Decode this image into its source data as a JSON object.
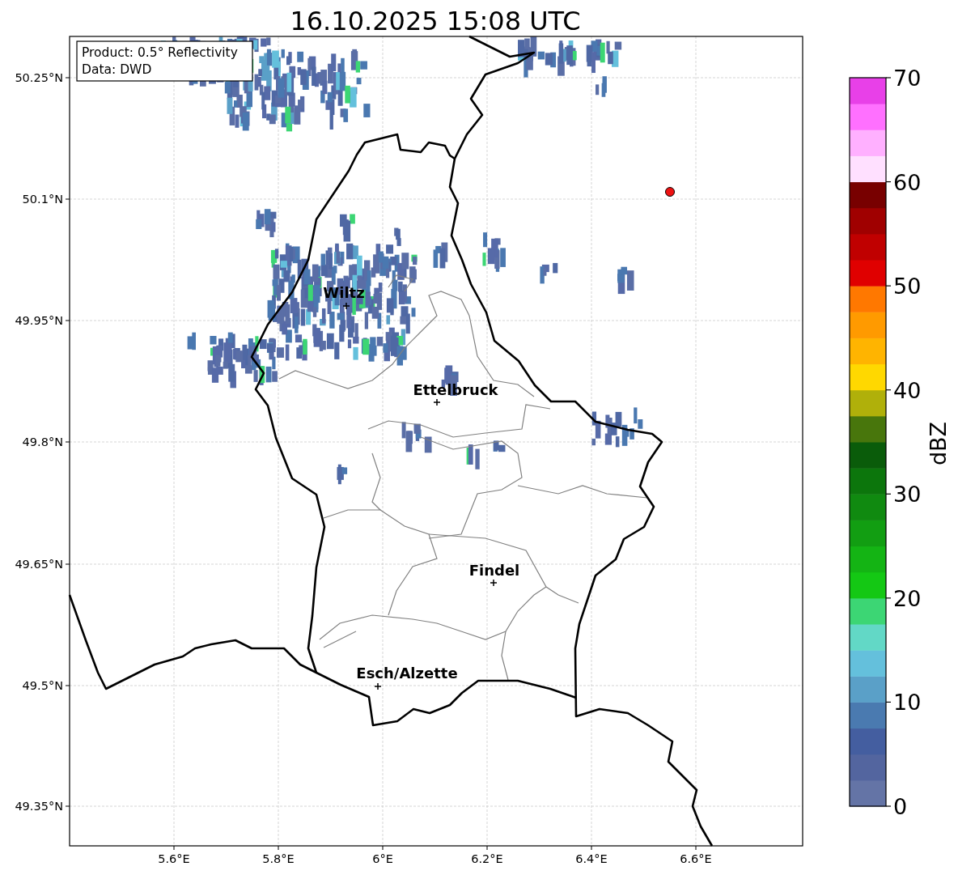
{
  "title": "16.10.2025 15:08 UTC",
  "info_box": [
    "Product: 0.5° Reflectivity",
    "Data: DWD"
  ],
  "y_axis_labels": [
    "50.25°N",
    "50.1°N",
    "49.95°N",
    "49.8°N",
    "49.65°N",
    "49.5°N",
    "49.35°N"
  ],
  "x_axis_labels": [
    "5.6°E",
    "5.8°E",
    "6°E",
    "6.2°E",
    "6.4°E",
    "6.6°E"
  ],
  "cities": [
    {
      "name": "Wiltz"
    },
    {
      "name": "Ettelbruck"
    },
    {
      "name": "Findel"
    },
    {
      "name": "Esch/Alzette"
    }
  ],
  "colorbar": {
    "label": "dBZ",
    "ticks": [
      "70",
      "60",
      "50",
      "40",
      "30",
      "20",
      "10",
      "0"
    ],
    "bins": [
      {
        "color": "#6474a6"
      },
      {
        "color": "#53659f"
      },
      {
        "color": "#445ea0"
      },
      {
        "color": "#4a7ab0"
      },
      {
        "color": "#5aa0c8"
      },
      {
        "color": "#64c0dc"
      },
      {
        "color": "#62d8c6"
      },
      {
        "color": "#3cd674"
      },
      {
        "color": "#14c814"
      },
      {
        "color": "#14b414"
      },
      {
        "color": "#129e12"
      },
      {
        "color": "#108a10"
      },
      {
        "color": "#0c760c"
      },
      {
        "color": "#0a5c0a"
      },
      {
        "color": "#48760c"
      },
      {
        "color": "#b0b00a"
      },
      {
        "color": "#ffd800"
      },
      {
        "color": "#ffb400"
      },
      {
        "color": "#ff9a00"
      },
      {
        "color": "#ff7800"
      },
      {
        "color": "#e00000"
      },
      {
        "color": "#c00000"
      },
      {
        "color": "#a00000"
      },
      {
        "color": "#780000"
      },
      {
        "color": "#ffe0ff"
      },
      {
        "color": "#ffb0ff"
      },
      {
        "color": "#ff70ff"
      },
      {
        "color": "#e840e8"
      }
    ]
  }
}
